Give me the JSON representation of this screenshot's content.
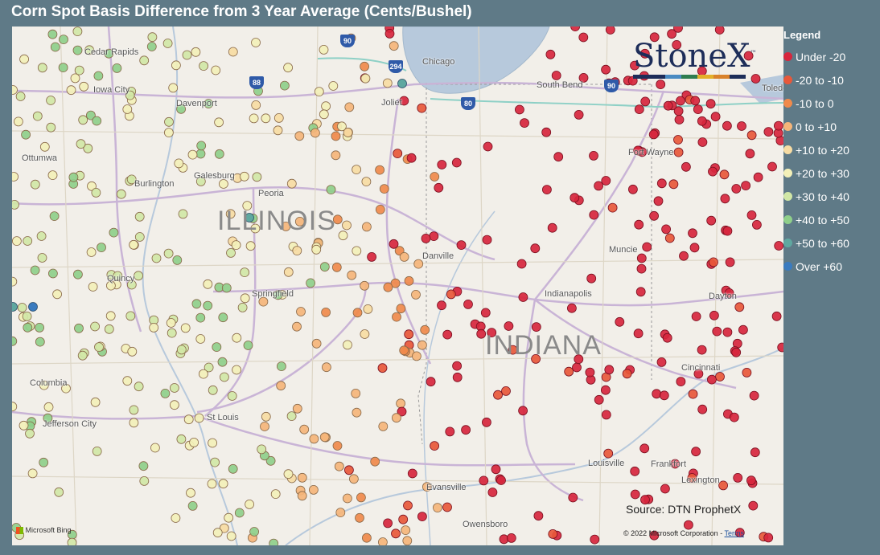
{
  "title": "Corn Spot Basis Difference from 3 Year Average (Cents/Bushel)",
  "logo": "StoneX",
  "logo_tm": "™",
  "source": "Source: DTN ProphetX",
  "bing": "Microsoft Bing",
  "copyright": "© 2022 Microsoft Corporation",
  "terms": "Terms",
  "legend": {
    "title": "Legend",
    "items": [
      {
        "label": "Under -20",
        "color": "#d7263d"
      },
      {
        "label": "-20 to -10",
        "color": "#e8583a"
      },
      {
        "label": "-10 to 0",
        "color": "#f08a4b"
      },
      {
        "label": "0 to +10",
        "color": "#f5b57a"
      },
      {
        "label": "+10 to +20",
        "color": "#f7dca3"
      },
      {
        "label": "+20 to +30",
        "color": "#f3f0b8"
      },
      {
        "label": "+30 to +40",
        "color": "#d1e7a6"
      },
      {
        "label": "+40 to +50",
        "color": "#8fcf8a"
      },
      {
        "label": "+50 to +60",
        "color": "#5fa8a0"
      },
      {
        "label": "Over +60",
        "color": "#3a7bbf"
      }
    ]
  },
  "map": {
    "states": [
      "ILLINOIS",
      "INDIANA"
    ],
    "cities": [
      "Cedar Rapids",
      "Iowa City",
      "Davenport",
      "Ottumwa",
      "Galesburg",
      "Burlington",
      "Peoria",
      "Quincy",
      "Springfield",
      "Columbia",
      "Jefferson City",
      "St Louis",
      "Chicago",
      "Joliet",
      "South Bend",
      "Fort Wayne",
      "Toledo",
      "Danville",
      "Muncie",
      "Indianapolis",
      "Dayton",
      "Cincinnati",
      "Louisville",
      "Frankfort",
      "Lexington",
      "Evansville",
      "Owensboro"
    ],
    "shields": [
      "90",
      "294",
      "88",
      "80",
      "90"
    ]
  }
}
